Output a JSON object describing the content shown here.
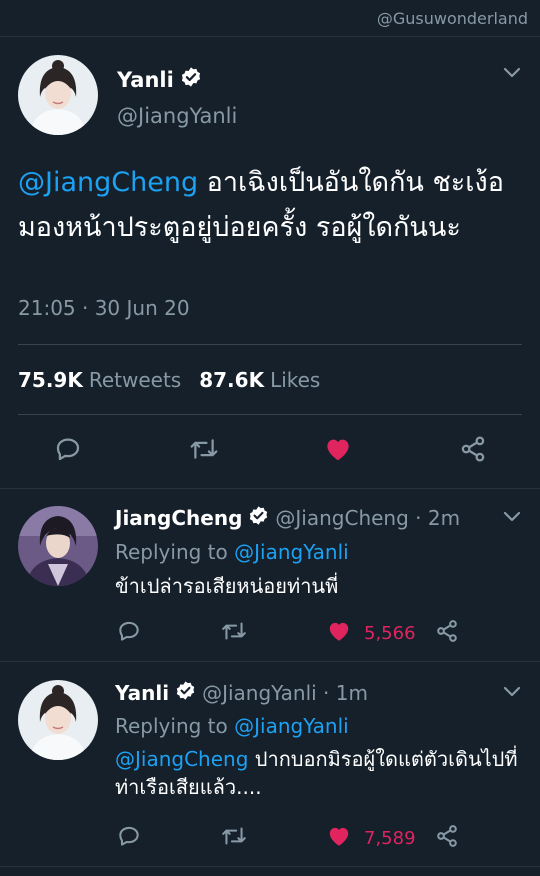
{
  "watermark": "@Gusuwonderland",
  "main_tweet": {
    "name": "Yanli",
    "handle": "@JiangYanli",
    "mention": "@JiangCheng",
    "text_rest": " อาเฉิงเป็นอันใดกัน ชะเง้อมองหน้าประตูอยู่บ่อยครั้ง รอผู้ใดกันนะ",
    "timestamp": "21:05 · 30 Jun 20",
    "retweets_count": "75.9K",
    "retweets_label": "Retweets",
    "likes_count": "87.6K",
    "likes_label": "Likes",
    "liked": true
  },
  "replies": [
    {
      "name": "JiangCheng",
      "meta": "@JiangCheng · 2m",
      "replying_prefix": "Replying to ",
      "replying_to": "@JiangYanli",
      "mention": "",
      "text": "ข้าเปล่ารอเสียหน่อยท่านพี่",
      "likes": "5,566",
      "liked": true
    },
    {
      "name": "Yanli",
      "meta": "@JiangYanli · 1m",
      "replying_prefix": "Replying to ",
      "replying_to": "@JiangYanli",
      "mention": "@JiangCheng",
      "text": " ปากบอกมิรอผู้ใดแต่ตัวเดินไปที่ท่าเรือเสียแล้ว....",
      "likes": "7,589",
      "liked": true
    }
  ],
  "colors": {
    "background": "#15202b",
    "accent": "#1da1f2",
    "like": "#e0245e",
    "muted": "#8899a6"
  },
  "icons": [
    "verified-badge-icon",
    "chevron-down-icon",
    "reply-icon",
    "retweet-icon",
    "heart-icon",
    "share-icon"
  ]
}
